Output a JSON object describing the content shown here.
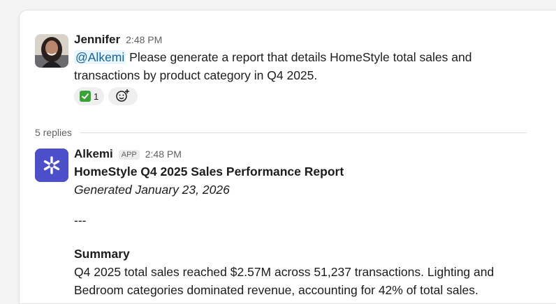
{
  "thread": {
    "parent": {
      "author": "Jennifer",
      "time": "2:48 PM",
      "mention": "@Alkemi",
      "text": "Please generate a report that details HomeStyle total sales and transactions by product category in Q4 2025.",
      "reaction": {
        "icon": "white-check-mark-icon",
        "count": "1"
      },
      "add_reaction_icon": "add-emoji-icon"
    },
    "replies_label": "5 replies",
    "reply": {
      "author": "Alkemi",
      "badge": "APP",
      "time": "2:48 PM",
      "title": "HomeStyle Q4 2025 Sales Performance Report",
      "generated": "Generated January 23, 2026",
      "separator": "---",
      "summary_heading": "Summary",
      "summary_text": "Q4 2025 total sales reached $2.57M across 51,237 transactions. Lighting and Bedroom categories dominated revenue, accounting for 42% of total sales."
    }
  },
  "colors": {
    "mention": "#1264a3",
    "app_avatar": "#4b4fc9",
    "reaction_check": "#3aa335"
  }
}
